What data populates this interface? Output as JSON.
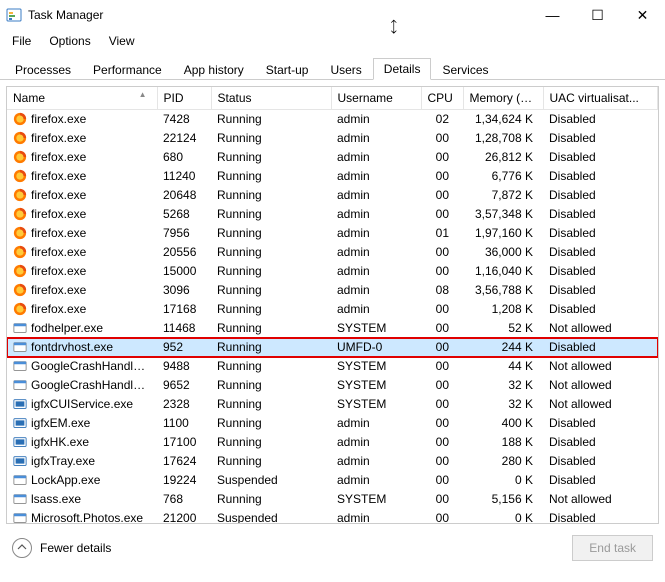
{
  "window": {
    "title": "Task Manager",
    "controls": {
      "min": "—",
      "max": "☐",
      "close": "✕"
    }
  },
  "menu": {
    "file": "File",
    "options": "Options",
    "view": "View"
  },
  "tabs": {
    "processes": "Processes",
    "performance": "Performance",
    "apphistory": "App history",
    "startup": "Start-up",
    "users": "Users",
    "details": "Details",
    "services": "Services"
  },
  "columns": {
    "name": "Name",
    "pid": "PID",
    "status": "Status",
    "username": "Username",
    "cpu": "CPU",
    "memory": "Memory (a...",
    "uac": "UAC virtualisat..."
  },
  "rows": [
    {
      "icon": "firefox",
      "name": "firefox.exe",
      "pid": "7428",
      "status": "Running",
      "user": "admin",
      "cpu": "02",
      "mem": "1,34,624 K",
      "uac": "Disabled",
      "hl": false
    },
    {
      "icon": "firefox",
      "name": "firefox.exe",
      "pid": "22124",
      "status": "Running",
      "user": "admin",
      "cpu": "00",
      "mem": "1,28,708 K",
      "uac": "Disabled",
      "hl": false
    },
    {
      "icon": "firefox",
      "name": "firefox.exe",
      "pid": "680",
      "status": "Running",
      "user": "admin",
      "cpu": "00",
      "mem": "26,812 K",
      "uac": "Disabled",
      "hl": false
    },
    {
      "icon": "firefox",
      "name": "firefox.exe",
      "pid": "11240",
      "status": "Running",
      "user": "admin",
      "cpu": "00",
      "mem": "6,776 K",
      "uac": "Disabled",
      "hl": false
    },
    {
      "icon": "firefox",
      "name": "firefox.exe",
      "pid": "20648",
      "status": "Running",
      "user": "admin",
      "cpu": "00",
      "mem": "7,872 K",
      "uac": "Disabled",
      "hl": false
    },
    {
      "icon": "firefox",
      "name": "firefox.exe",
      "pid": "5268",
      "status": "Running",
      "user": "admin",
      "cpu": "00",
      "mem": "3,57,348 K",
      "uac": "Disabled",
      "hl": false
    },
    {
      "icon": "firefox",
      "name": "firefox.exe",
      "pid": "7956",
      "status": "Running",
      "user": "admin",
      "cpu": "01",
      "mem": "1,97,160 K",
      "uac": "Disabled",
      "hl": false
    },
    {
      "icon": "firefox",
      "name": "firefox.exe",
      "pid": "20556",
      "status": "Running",
      "user": "admin",
      "cpu": "00",
      "mem": "36,000 K",
      "uac": "Disabled",
      "hl": false
    },
    {
      "icon": "firefox",
      "name": "firefox.exe",
      "pid": "15000",
      "status": "Running",
      "user": "admin",
      "cpu": "00",
      "mem": "1,16,040 K",
      "uac": "Disabled",
      "hl": false
    },
    {
      "icon": "firefox",
      "name": "firefox.exe",
      "pid": "3096",
      "status": "Running",
      "user": "admin",
      "cpu": "08",
      "mem": "3,56,788 K",
      "uac": "Disabled",
      "hl": false
    },
    {
      "icon": "firefox",
      "name": "firefox.exe",
      "pid": "17168",
      "status": "Running",
      "user": "admin",
      "cpu": "00",
      "mem": "1,208 K",
      "uac": "Disabled",
      "hl": false
    },
    {
      "icon": "generic",
      "name": "fodhelper.exe",
      "pid": "11468",
      "status": "Running",
      "user": "SYSTEM",
      "cpu": "00",
      "mem": "52 K",
      "uac": "Not allowed",
      "hl": false
    },
    {
      "icon": "generic",
      "name": "fontdrvhost.exe",
      "pid": "952",
      "status": "Running",
      "user": "UMFD-0",
      "cpu": "00",
      "mem": "244 K",
      "uac": "Disabled",
      "hl": true
    },
    {
      "icon": "generic",
      "name": "GoogleCrashHandler...",
      "pid": "9488",
      "status": "Running",
      "user": "SYSTEM",
      "cpu": "00",
      "mem": "44 K",
      "uac": "Not allowed",
      "hl": false
    },
    {
      "icon": "generic",
      "name": "GoogleCrashHandler...",
      "pid": "9652",
      "status": "Running",
      "user": "SYSTEM",
      "cpu": "00",
      "mem": "32 K",
      "uac": "Not allowed",
      "hl": false
    },
    {
      "icon": "igfx",
      "name": "igfxCUIService.exe",
      "pid": "2328",
      "status": "Running",
      "user": "SYSTEM",
      "cpu": "00",
      "mem": "32 K",
      "uac": "Not allowed",
      "hl": false
    },
    {
      "icon": "igfx",
      "name": "igfxEM.exe",
      "pid": "1100",
      "status": "Running",
      "user": "admin",
      "cpu": "00",
      "mem": "400 K",
      "uac": "Disabled",
      "hl": false
    },
    {
      "icon": "igfx",
      "name": "igfxHK.exe",
      "pid": "17100",
      "status": "Running",
      "user": "admin",
      "cpu": "00",
      "mem": "188 K",
      "uac": "Disabled",
      "hl": false
    },
    {
      "icon": "igfx",
      "name": "igfxTray.exe",
      "pid": "17624",
      "status": "Running",
      "user": "admin",
      "cpu": "00",
      "mem": "280 K",
      "uac": "Disabled",
      "hl": false
    },
    {
      "icon": "generic",
      "name": "LockApp.exe",
      "pid": "19224",
      "status": "Suspended",
      "user": "admin",
      "cpu": "00",
      "mem": "0 K",
      "uac": "Disabled",
      "hl": false
    },
    {
      "icon": "generic",
      "name": "lsass.exe",
      "pid": "768",
      "status": "Running",
      "user": "SYSTEM",
      "cpu": "00",
      "mem": "5,156 K",
      "uac": "Not allowed",
      "hl": false
    },
    {
      "icon": "generic",
      "name": "Microsoft.Photos.exe",
      "pid": "21200",
      "status": "Suspended",
      "user": "admin",
      "cpu": "00",
      "mem": "0 K",
      "uac": "Disabled",
      "hl": false
    }
  ],
  "footer": {
    "fewer": "Fewer details",
    "endtask": "End task"
  }
}
